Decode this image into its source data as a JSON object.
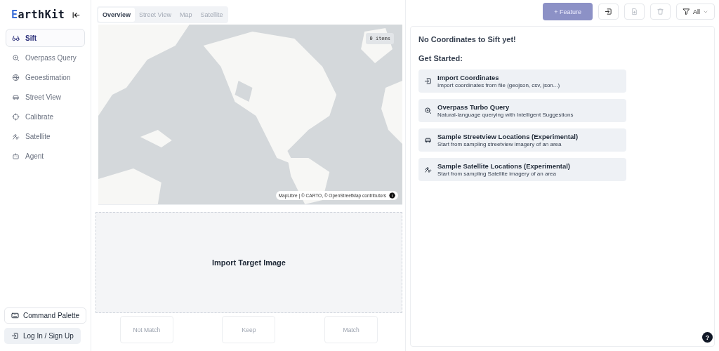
{
  "sidebar": {
    "logo": "EarthKit",
    "items": [
      {
        "label": "Sift",
        "selected": true
      },
      {
        "label": "Overpass Query",
        "selected": false
      },
      {
        "label": "Geoestimation",
        "selected": false
      },
      {
        "label": "Street View",
        "selected": false
      },
      {
        "label": "Calibrate",
        "selected": false
      },
      {
        "label": "Satellite",
        "selected": false
      },
      {
        "label": "Agent",
        "selected": false
      }
    ],
    "command_palette": "Command Palette",
    "login": "Log In / Sign Up"
  },
  "viewer": {
    "tabs": [
      {
        "label": "Overview",
        "selected": true,
        "disabled": false
      },
      {
        "label": "Street View",
        "selected": false,
        "disabled": true
      },
      {
        "label": "Map",
        "selected": false,
        "disabled": true
      },
      {
        "label": "Satellite",
        "selected": false,
        "disabled": true
      }
    ],
    "map": {
      "kind": "picture",
      "count": "0 items",
      "attribution": "MapLibre | © CARTO, © OpenStreetMap contributors"
    },
    "drop_zone": "Import Target Image",
    "actions": [
      {
        "label": "Not Match",
        "disabled": true
      },
      {
        "label": "Keep",
        "disabled": true
      },
      {
        "label": "Match",
        "disabled": true
      }
    ]
  },
  "toolbar": {
    "feature": {
      "label": "+ Feature",
      "disabled": true
    },
    "icon_buttons": [
      {
        "disabled": false
      },
      {
        "disabled": true
      },
      {
        "disabled": true
      }
    ],
    "filter": "All"
  },
  "panel": {
    "title": "No Coordinates to Sift yet!",
    "subtitle": "Get Started:",
    "options": [
      {
        "title": "Import Coordinates",
        "description": "Import coordinates from file (geojson, csv, json...)"
      },
      {
        "title": "Overpass Turbo Query",
        "description": "Natural-language querying with Intelligent Suggestions"
      },
      {
        "title": "Sample Streetview Locations (Experimental)",
        "description": "Start from sampling streetview imagery of an area"
      },
      {
        "title": "Sample Satellite Locations (Experimental)",
        "description": "Start from sampling Satellite imagery of an area"
      }
    ]
  },
  "help": "?"
}
